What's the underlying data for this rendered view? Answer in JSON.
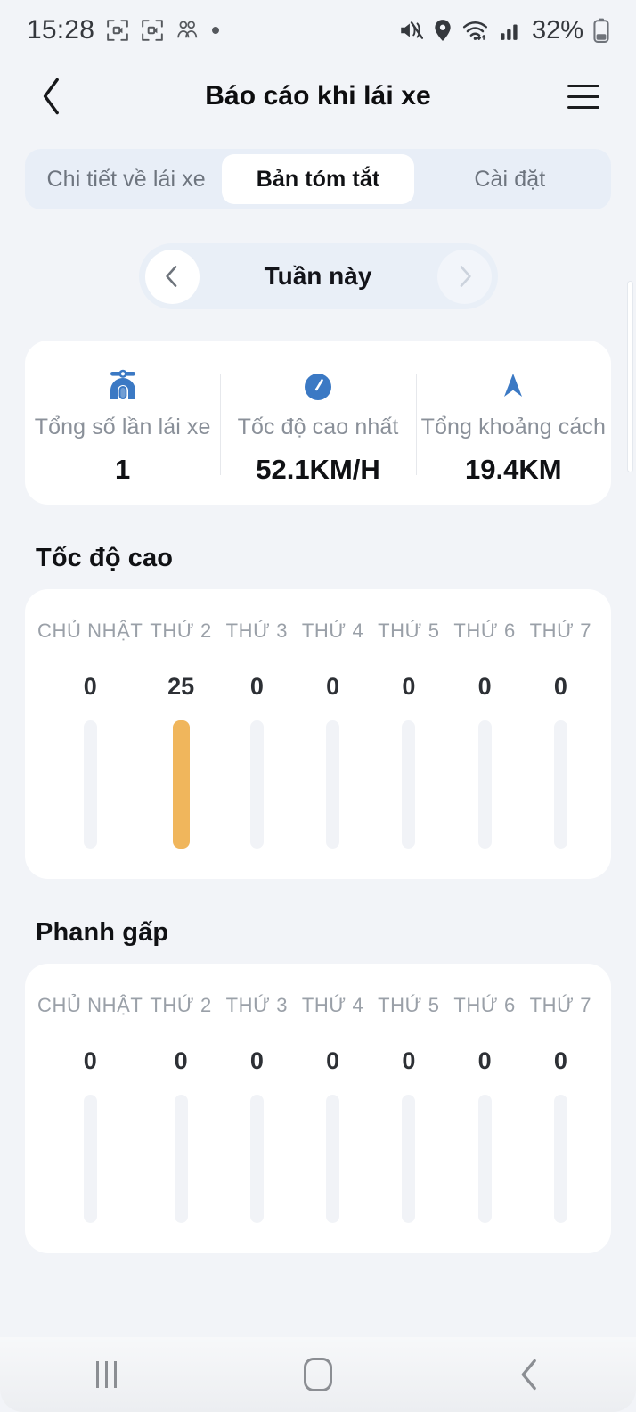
{
  "status_bar": {
    "time": "15:28",
    "battery_text": "32%",
    "icons": [
      "screen-record-icon",
      "screen-record-icon",
      "people-icon",
      "dot-icon",
      "mute-icon",
      "location-icon",
      "wifi-icon",
      "signal-icon",
      "battery-icon"
    ]
  },
  "header": {
    "title": "Báo cáo khi lái xe",
    "back_icon": "chevron-left-icon",
    "menu_icon": "hamburger-menu-icon"
  },
  "tabs": [
    {
      "label": "Chi tiết về lái xe",
      "active": false
    },
    {
      "label": "Bản tóm tắt",
      "active": true
    },
    {
      "label": "Cài đặt",
      "active": false
    }
  ],
  "week_selector": {
    "label": "Tuần này",
    "prev_icon": "chevron-left-icon",
    "next_icon": "chevron-right-icon",
    "next_enabled": false
  },
  "stats": [
    {
      "icon": "scooter-icon",
      "label": "Tổng số lần lái xe",
      "value": "1"
    },
    {
      "icon": "speedometer-icon",
      "label": "Tốc độ cao nhất",
      "value": "52.1KM/H"
    },
    {
      "icon": "navigation-arrow-icon",
      "label": "Tổng khoảng cách",
      "value": "19.4KM"
    }
  ],
  "colors": {
    "accent_blue": "#3b79c4",
    "bar_orange": "#f0b65c",
    "bar_track": "#f1f3f7",
    "page_bg": "#f2f4f8"
  },
  "chart_data": [
    {
      "type": "bar",
      "title": "Tốc độ cao",
      "categories": [
        "CHỦ NHẬT",
        "THỨ 2",
        "THỨ 3",
        "THỨ 4",
        "THỨ 5",
        "THỨ 6",
        "THỨ 7"
      ],
      "values": [
        0,
        25,
        0,
        0,
        0,
        0,
        0
      ],
      "value_labels": [
        "0",
        "25",
        "0",
        "0",
        "0",
        "0",
        "0"
      ],
      "xlabel": "",
      "ylabel": "",
      "ylim": [
        0,
        25
      ],
      "grid": false,
      "legend": "none",
      "bar_color": "#f0b65c",
      "track_color": "#f1f3f7"
    },
    {
      "type": "bar",
      "title": "Phanh gấp",
      "categories": [
        "CHỦ NHẬT",
        "THỨ 2",
        "THỨ 3",
        "THỨ 4",
        "THỨ 5",
        "THỨ 6",
        "THỨ 7"
      ],
      "values": [
        0,
        0,
        0,
        0,
        0,
        0,
        0
      ],
      "value_labels": [
        "0",
        "0",
        "0",
        "0",
        "0",
        "0",
        "0"
      ],
      "xlabel": "",
      "ylabel": "",
      "ylim": [
        0,
        25
      ],
      "grid": false,
      "legend": "none",
      "bar_color": "#f0b65c",
      "track_color": "#f1f3f7"
    }
  ],
  "nav_bar": {
    "recents_icon": "recents-icon",
    "home_icon": "home-icon",
    "back_icon": "back-icon"
  }
}
